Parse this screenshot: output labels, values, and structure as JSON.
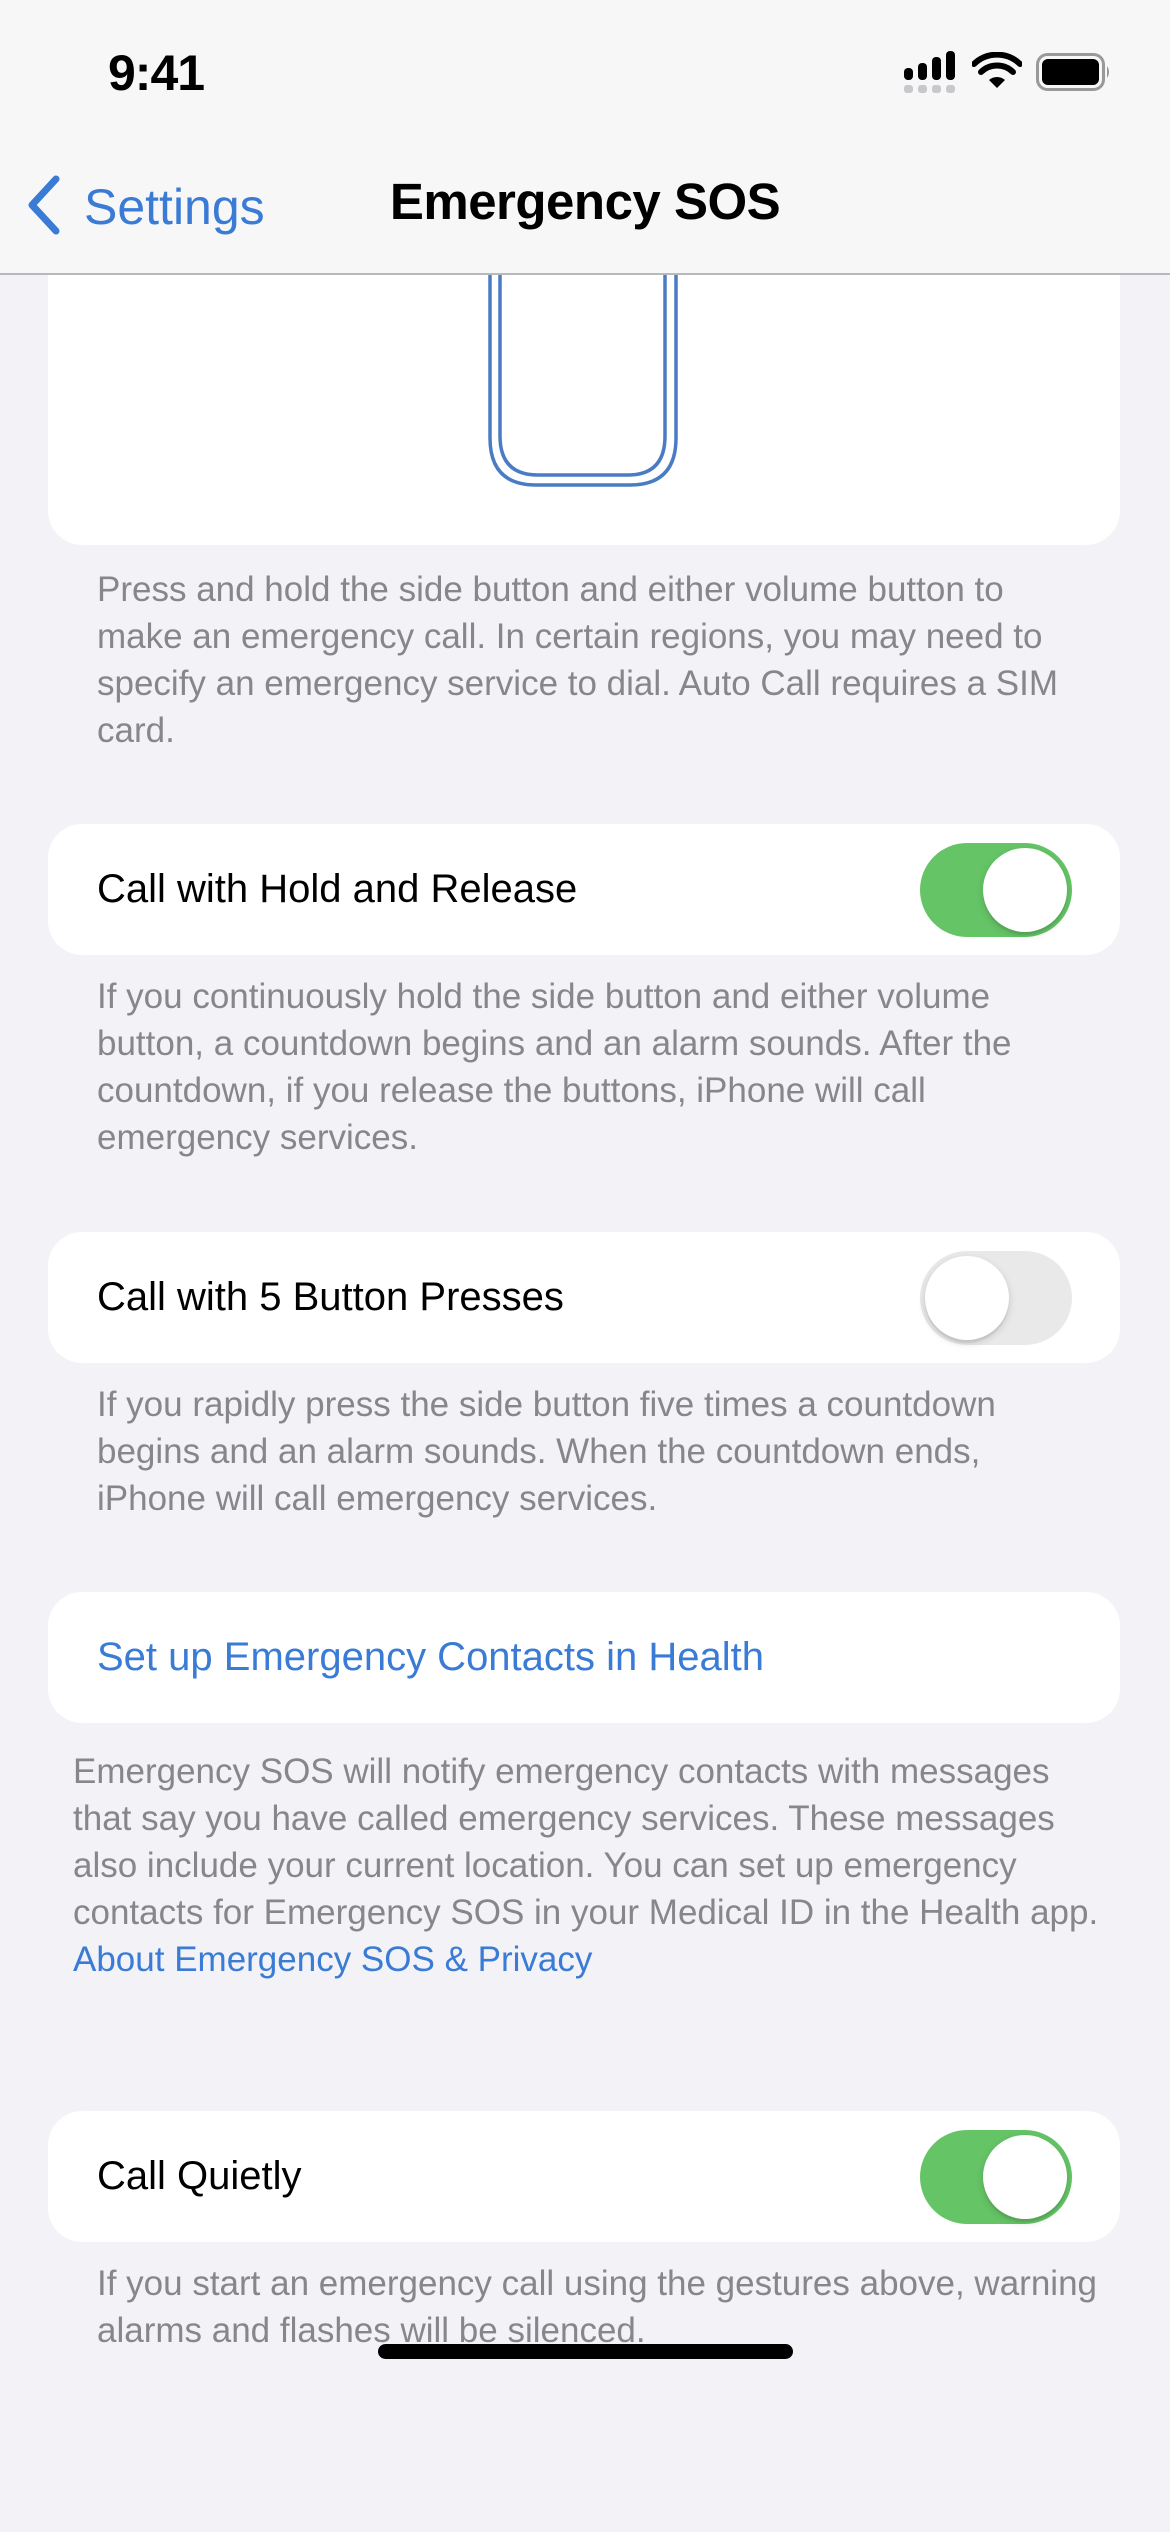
{
  "status_bar": {
    "time": "9:41",
    "icons": [
      "cellular-signal-icon",
      "wifi-icon",
      "battery-icon"
    ]
  },
  "nav": {
    "back_label": "Settings",
    "back_icon": "chevron-left-icon",
    "title": "Emergency SOS"
  },
  "colors": {
    "accent": "#3a7bd5",
    "toggle_on": "#65c466",
    "toggle_off": "#e9e9ea",
    "background": "#f2f2f7",
    "secondary_text": "#86868b"
  },
  "illustration": {
    "icon": "iphone-outline-icon"
  },
  "sections": {
    "side_button_footer": "Press and hold the side button and either volume button to make an emergency call. In certain regions, you may need to specify an emergency service to dial. Auto Call requires a SIM card.",
    "hold_release": {
      "label": "Call with Hold and Release",
      "enabled": true,
      "footer": "If you continuously hold the side button and either volume button, a countdown begins and an alarm sounds. After the countdown, if you release the buttons, iPhone will call emergency services."
    },
    "five_presses": {
      "label": "Call with 5 Button Presses",
      "enabled": false,
      "footer": "If you rapidly press the side button five times a countdown begins and an alarm sounds. When the countdown ends, iPhone will call emergency services."
    },
    "emergency_contacts": {
      "link_label": "Set up Emergency Contacts in Health",
      "footer": "Emergency SOS will notify emergency contacts with messages that say you have called emergency services. These messages also include your current location. You can set up emergency contacts for Emergency SOS in your Medical ID in the Health app.",
      "footer_link": "About Emergency SOS & Privacy"
    },
    "call_quietly": {
      "label": "Call Quietly",
      "enabled": true,
      "footer": "If you start an emergency call using the gestures above, warning alarms and flashes will be silenced."
    }
  }
}
